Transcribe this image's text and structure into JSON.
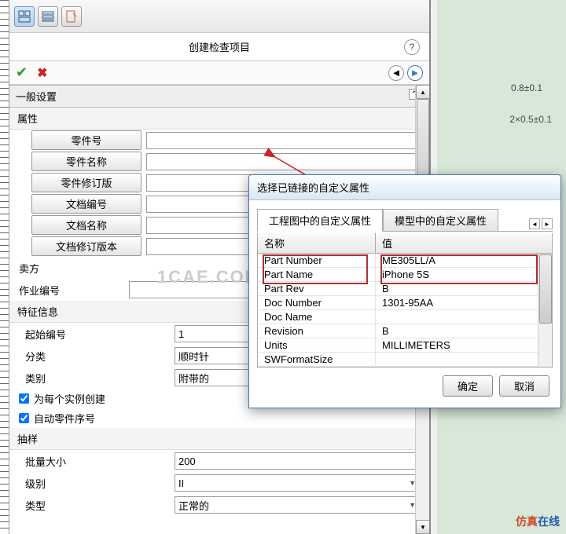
{
  "panel": {
    "title": "创建检查项目",
    "section_general": "一般设置",
    "sub_props": "属性",
    "fields": {
      "part_number": "零件号",
      "part_name": "零件名称",
      "part_rev": "零件修订版",
      "doc_number": "文档编号",
      "doc_name": "文档名称",
      "doc_rev": "文档修订版本"
    },
    "seller": "卖方",
    "job_number": "作业编号",
    "section_feature": "特征信息",
    "start_number": "起始编号",
    "start_number_val": "1",
    "classification": "分类",
    "classification_val": "顺时针",
    "category": "类别",
    "category_val": "附带的",
    "chk_each_instance": "为每个实例创建",
    "chk_auto_part_seq": "自动零件序号",
    "section_sampling": "抽样",
    "batch_size": "批量大小",
    "batch_size_val": "200",
    "level": "级别",
    "level_val": "II",
    "type": "类型",
    "type_val": "正常的"
  },
  "canvas": {
    "dim1": "0.8±0.1",
    "dim2": "2×0.5±0.1"
  },
  "dialog": {
    "title": "选择已链接的自定义属性",
    "tab1": "工程图中的自定义属性",
    "tab2": "模型中的自定义属性",
    "col_name": "名称",
    "col_value": "值",
    "rows": [
      {
        "name": "Part Number",
        "value": "ME305LL/A"
      },
      {
        "name": "Part Name",
        "value": "iPhone 5S"
      },
      {
        "name": "Part Rev",
        "value": "B"
      },
      {
        "name": "Doc Number",
        "value": "1301-95AA"
      },
      {
        "name": "Doc Name",
        "value": ""
      },
      {
        "name": "Revision",
        "value": "B"
      },
      {
        "name": "Units",
        "value": "MILLIMETERS"
      },
      {
        "name": "SWFormatSize",
        "value": ""
      }
    ],
    "ok": "确定",
    "cancel": "取消"
  },
  "watermark": {
    "a": "仿真",
    "b": "在线"
  },
  "center_wm": "1CAE.COM"
}
